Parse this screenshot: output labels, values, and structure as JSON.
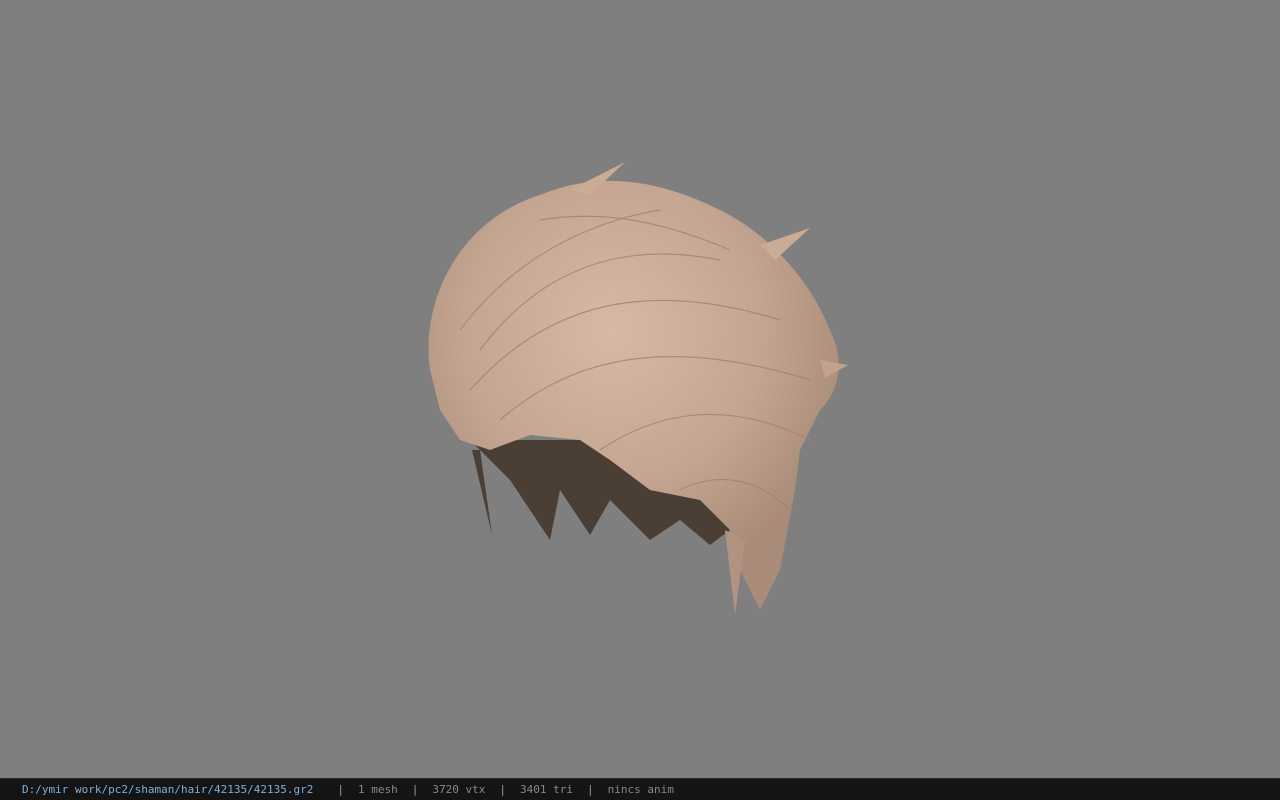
{
  "viewport": {
    "background_color": "#7f7f7f",
    "model": {
      "name": "hair-model",
      "hair_color_light": "#c9ab96",
      "hair_color_mid": "#b29381",
      "hair_color_dark": "#4a3e35"
    }
  },
  "statusbar": {
    "path": "D:/ymir work/pc2/shaman/hair/42135/42135.gr2",
    "separator": "|",
    "mesh": "1 mesh",
    "vtx": "3720 vtx",
    "tri": "3401 tri",
    "anim": "nincs anim",
    "path_color": "#7fb0d8",
    "text_color": "#8a8a8a"
  }
}
